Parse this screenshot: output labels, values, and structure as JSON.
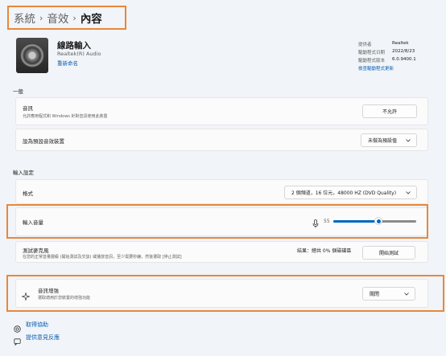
{
  "breadcrumb": {
    "items": [
      "系統",
      "音效"
    ],
    "current": "內容"
  },
  "device": {
    "name": "線路輸入",
    "driver": "Realtek(R) Audio",
    "rename": "重新命名"
  },
  "info": {
    "rows": [
      {
        "label": "提供者",
        "value": "Realtek"
      },
      {
        "label": "驅動程式日期",
        "value": "2022/8/23"
      },
      {
        "label": "驅動程式版本",
        "value": "6.0.9400.1"
      }
    ],
    "update_link": "檢查驅動程式更新"
  },
  "general": {
    "title": "一般",
    "audio": {
      "title": "音訊",
      "desc": "允許應用程式和 Windows 針對音訊使用此裝置",
      "button": "不允許"
    },
    "default": {
      "title": "設為預設音效裝置",
      "dropdown": "未做為預設值"
    }
  },
  "input": {
    "title": "輸入設定",
    "format": {
      "title": "格式",
      "dropdown": "2 個頻道，16 位元，48000 HZ (DVD Quality)"
    },
    "volume": {
      "title": "輸入音量",
      "value": "55",
      "level": 55
    },
    "test": {
      "title": "測試麥克風",
      "desc": "在您的正常音量層級 (開始測試及交談) 或播放音訊，至少需要秒鐘，然後選取 [停止測試]",
      "result": "結果：總共 0% 個磁碟區",
      "button": "開始測試"
    },
    "enhance": {
      "title": "音訊增強",
      "desc": "選取適用於您裝置的增強功能",
      "dropdown": "關閉"
    }
  },
  "footer": {
    "help": "取得協助",
    "feedback": "提供意見反應"
  },
  "colors": {
    "accent": "#0067c0",
    "highlight": "#e8883a",
    "link": "#0a5fb4"
  }
}
